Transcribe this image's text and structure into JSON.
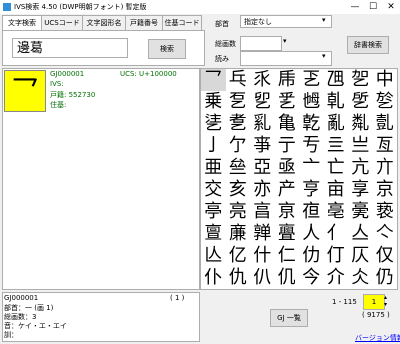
{
  "window": {
    "title": "IVS検索 4.50 (DWP明朝フォント) 暫定版",
    "minimize": "—",
    "maximize": "☐",
    "close": "✕"
  },
  "tabs": [
    {
      "label": "文字検索"
    },
    {
      "label": "UCSコード"
    },
    {
      "label": "文字図形名"
    },
    {
      "label": "戸籍番号"
    },
    {
      "label": "住基コード"
    }
  ],
  "search": {
    "query": "邊葛",
    "button": "検索"
  },
  "filters": {
    "bushu_label": "部首",
    "bushu_value": "指定なし",
    "kakusu_label": "総画数",
    "kakusu_value": "",
    "yomi_label": "読み",
    "yomi_value": "",
    "jisho_button": "辞書検索"
  },
  "detail": {
    "glyph": "乛",
    "id": "GJ000001",
    "ucs": "UCS: U+100000",
    "ivs": "IVS:",
    "koseki": "戸籍: 552730",
    "juki": "住基:"
  },
  "results": [
    [
      "乛",
      "乓",
      "乑",
      "乕",
      "乤",
      "乪",
      "乫",
      "中"
    ],
    [
      "乗",
      "乭",
      "乮",
      "乯",
      "乸",
      "乹",
      "乺",
      "乻"
    ],
    [
      "乼",
      "乽",
      "乿",
      "亀",
      "亁",
      "亂",
      "亃",
      "亄"
    ],
    [
      "亅",
      "亇",
      "亊",
      "亍",
      "亐",
      "亖",
      "亗",
      "亙"
    ],
    [
      "亜",
      "亝",
      "亞",
      "亟",
      "亠",
      "亡",
      "亢",
      "亣"
    ],
    [
      "交",
      "亥",
      "亦",
      "产",
      "亨",
      "亩",
      "享",
      "京"
    ],
    [
      "亭",
      "亮",
      "亯",
      "亰",
      "亱",
      "亳",
      "亴",
      "亵"
    ],
    [
      "亶",
      "亷",
      "亸",
      "亹",
      "人",
      "亻",
      "亼",
      "亽"
    ],
    [
      "亾",
      "亿",
      "什",
      "仁",
      "仂",
      "仃",
      "仄",
      "仅"
    ],
    [
      "仆",
      "仇",
      "仈",
      "仉",
      "今",
      "介",
      "仌",
      "仍"
    ]
  ],
  "bottom": {
    "line1": "GJ000001",
    "count_label": "( 1 )",
    "line2": "部首：一 (画 1)",
    "line3": "総画数：3",
    "line4": "音：ケイ・エ・エイ",
    "line5": "訓：",
    "range": "1 - 115",
    "page": "1",
    "total": "( 9175 )",
    "list_button": "GJ 一覧",
    "version_link": "バージョン情報"
  },
  "colors": {
    "highlight": "#ffff00",
    "link": "#0000ff"
  }
}
